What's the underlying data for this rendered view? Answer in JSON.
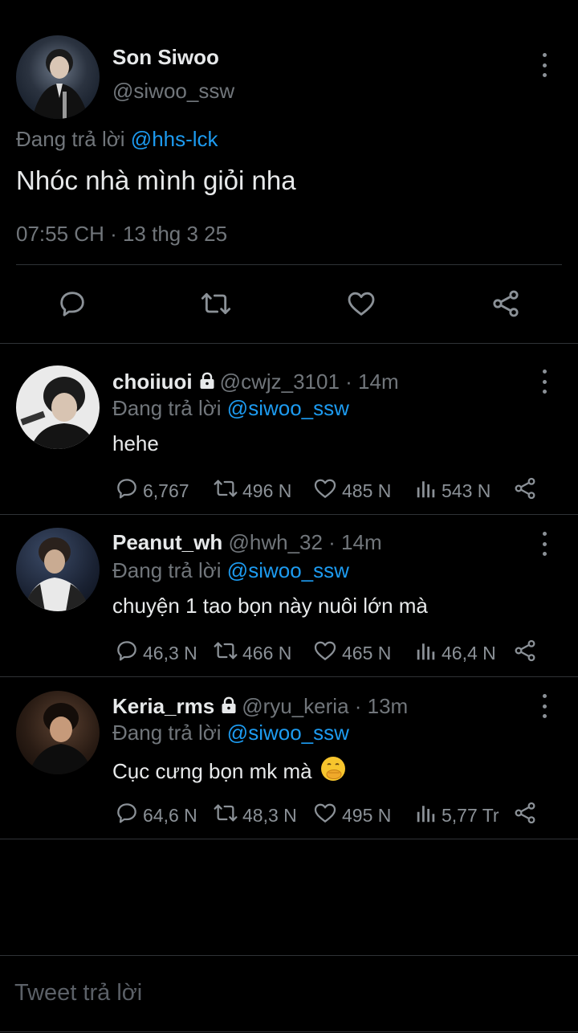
{
  "main_tweet": {
    "author_name": "Son Siwoo",
    "handle": "@siwoo_ssw",
    "reply_prefix": "Đang trả lời",
    "reply_to": "@hhs-lck",
    "text": "Nhóc nhà mình giỏi nha",
    "timestamp": "07:55 CH · 13 thg 3 25"
  },
  "replies": [
    {
      "name": "choiiuoi",
      "handle": "@cwjz_3101 · 14m",
      "reply_prefix": "Đang trả lời",
      "reply_to": "@siwoo_ssw",
      "text": "hehe",
      "comments": "6,767",
      "retweets": "496 N",
      "likes": "485 N",
      "views": "543 N"
    },
    {
      "name": "Peanut_wh",
      "handle": "@hwh_32 · 14m",
      "reply_prefix": "Đang trả lời",
      "reply_to": "@siwoo_ssw",
      "text": "chuyện 1 tao bọn này nuôi lớn mà",
      "comments": "46,3 N",
      "retweets": "466 N",
      "likes": "465 N",
      "views": "46,4 N"
    },
    {
      "name": "Keria_rms",
      "handle": "@ryu_keria · 13m",
      "reply_prefix": "Đang trả lời",
      "reply_to": "@siwoo_ssw",
      "text": "Cục cưng bọn mk mà",
      "comments": "64,6 N",
      "retweets": "48,3 N",
      "likes": "495 N",
      "views": "5,77 Tr"
    }
  ],
  "composer": {
    "placeholder": "Tweet trả lời"
  },
  "colors": {
    "accent": "#1d9bf0",
    "muted": "#71767b",
    "background": "#000000"
  }
}
